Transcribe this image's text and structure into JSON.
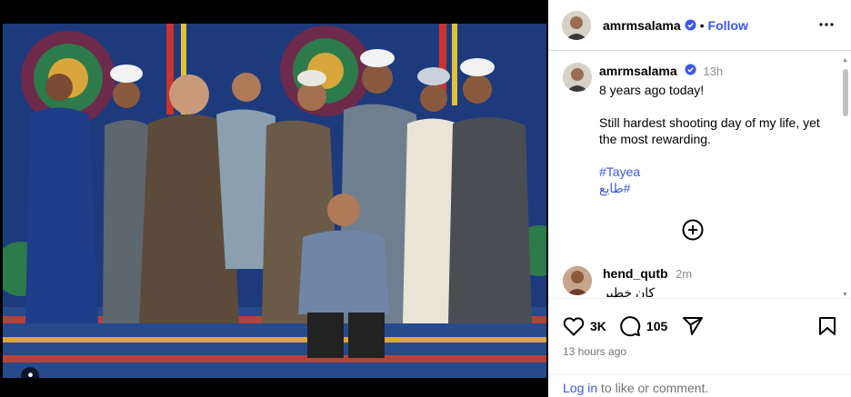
{
  "post": {
    "author": "amrmsalama",
    "follow_label": "Follow",
    "dot": "•"
  },
  "caption": {
    "author": "amrmsalama",
    "time": "13h",
    "line1": "8 years ago today!",
    "line2": "Still hardest shooting day of my life, yet the most rewarding.",
    "hashtags": [
      "#Tayea",
      "طايع#"
    ]
  },
  "comment": {
    "author": "hend_qutb",
    "time": "2m",
    "text": "كان خطير"
  },
  "actions": {
    "likes": "3K",
    "comments": "105",
    "timestamp": "13 hours ago"
  },
  "login": {
    "link": "Log in",
    "rest": " to like or comment."
  },
  "colors": {
    "link_blue": "#3a57e8",
    "backdrop_blue": "#1f3f86"
  },
  "icons": [
    "verified-icon",
    "more-icon",
    "plus-circle-icon",
    "heart-icon",
    "comment-icon",
    "share-icon",
    "save-icon",
    "tag-user-icon"
  ]
}
